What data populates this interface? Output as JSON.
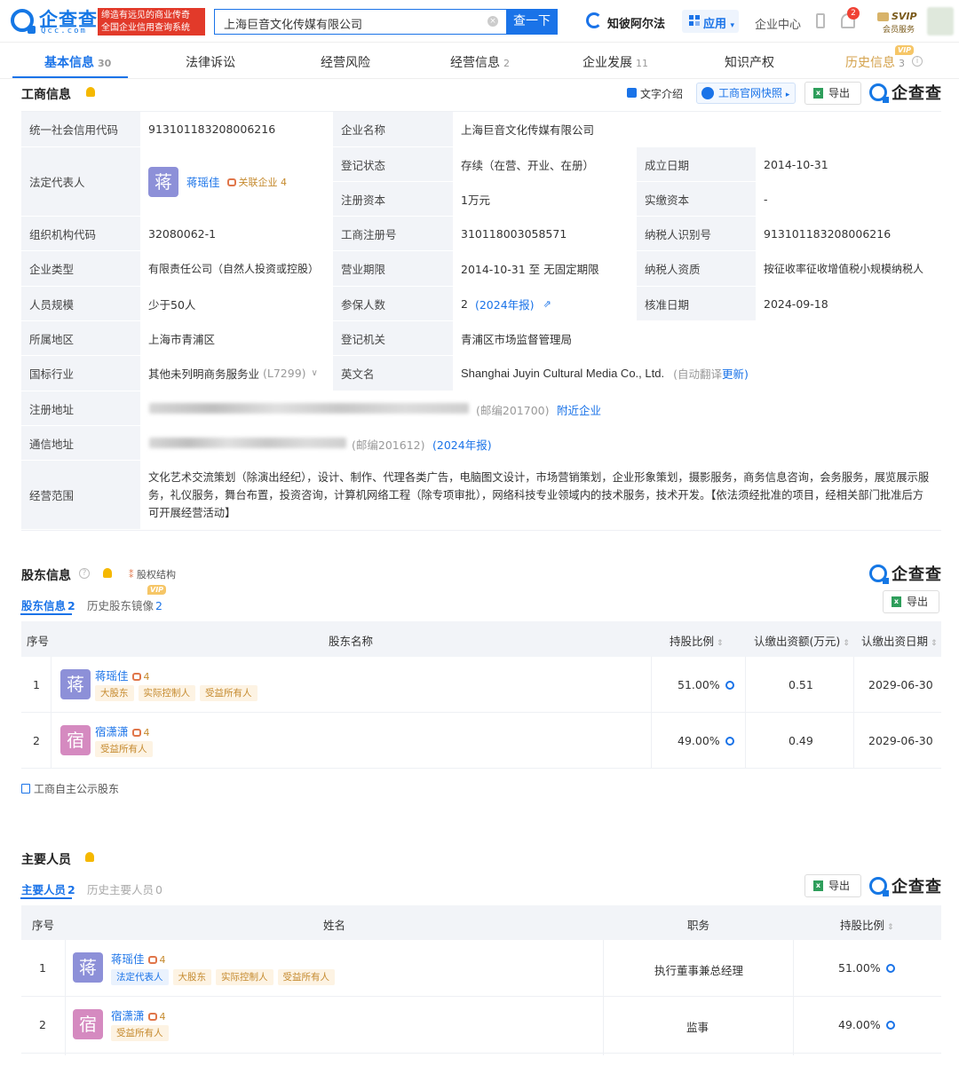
{
  "header": {
    "logo_text": "企查查",
    "logo_sub": "Qcc.com",
    "slogan_line1": "缔造有远见的商业传奇",
    "slogan_line2": "全国企业信用查询系统",
    "search_value": "上海巨音文化传媒有限公司",
    "search_button": "查一下",
    "zhibi_label": "知彼阿尔法",
    "app_label": "应用",
    "enterprise_center": "企业中心",
    "notification_count": "2",
    "svip_label": "SVIP",
    "svip_sub": "会员服务"
  },
  "tabs": [
    {
      "label": "基本信息",
      "count": "30"
    },
    {
      "label": "法律诉讼",
      "count": ""
    },
    {
      "label": "经营风险",
      "count": ""
    },
    {
      "label": "经营信息",
      "count": "2"
    },
    {
      "label": "企业发展",
      "count": "11"
    },
    {
      "label": "知识产权",
      "count": ""
    },
    {
      "label": "历史信息",
      "count": "3",
      "vip": "VIP"
    }
  ],
  "business": {
    "title": "工商信息",
    "text_intro": "文字介绍",
    "official_snapshot": "工商官网快照",
    "export": "导出",
    "logo": "企查查",
    "rows": {
      "credit_code_label": "统一社会信用代码",
      "credit_code": "913101183208006216",
      "company_name_label": "企业名称",
      "company_name": "上海巨音文化传媒有限公司",
      "legal_rep_label": "法定代表人",
      "legal_rep_avatar": "蒋",
      "legal_rep_name": "蒋瑶佳",
      "related_label": "关联企业",
      "related_count": "4",
      "reg_status_label": "登记状态",
      "reg_status": "存续（在营、开业、在册）",
      "found_date_label": "成立日期",
      "found_date": "2014-10-31",
      "reg_capital_label": "注册资本",
      "reg_capital": "1万元",
      "paid_capital_label": "实缴资本",
      "paid_capital": "-",
      "org_code_label": "组织机构代码",
      "org_code": "32080062-1",
      "reg_no_label": "工商注册号",
      "reg_no": "310118003058571",
      "taxpayer_id_label": "纳税人识别号",
      "taxpayer_id": "913101183208006216",
      "company_type_label": "企业类型",
      "company_type": "有限责任公司（自然人投资或控股）",
      "term_label": "营业期限",
      "term": "2014-10-31 至 无固定期限",
      "taxpayer_qual_label": "纳税人资质",
      "taxpayer_qual": "按征收率征收增值税小规模纳税人",
      "staff_label": "人员规模",
      "staff": "少于50人",
      "insured_label": "参保人数",
      "insured": "2",
      "insured_year": "(2024年报)",
      "approve_date_label": "核准日期",
      "approve_date": "2024-09-18",
      "region_label": "所属地区",
      "region": "上海市青浦区",
      "authority_label": "登记机关",
      "authority": "青浦区市场监督管理局",
      "industry_label": "国标行业",
      "industry": "其他未列明商务服务业",
      "industry_code": "(L7299)",
      "english_label": "英文名",
      "english": "Shanghai Juyin Cultural Media Co., Ltd.",
      "auto_translate": "(自动翻译",
      "update": "更新)",
      "reg_addr_label": "注册地址",
      "reg_zip": "(邮编201700)",
      "nearby": "附近企业",
      "mail_addr_label": "通信地址",
      "mail_zip": "(邮编201612)",
      "mail_year": "(2024年报)",
      "scope_label": "经营范围",
      "scope": "文化艺术交流策划（除演出经纪），设计、制作、代理各类广告，电脑图文设计，市场营销策划，企业形象策划，摄影服务，商务信息咨询，会务服务，展览展示服务，礼仪服务，舞台布置，投资咨询，计算机网络工程（除专项审批），网络科技专业领域内的技术服务，技术开发。【依法须经批准的项目，经相关部门批准后方可开展经营活动】"
    }
  },
  "shareholders": {
    "title": "股东信息",
    "equity_structure": "股权结构",
    "logo": "企查查",
    "export": "导出",
    "subtab_current": "股东信息",
    "subtab_current_count": "2",
    "subtab_history": "历史股东镜像",
    "subtab_history_count": "2",
    "vip": "VIP",
    "headers": {
      "no": "序号",
      "name": "股东名称",
      "ratio": "持股比例",
      "amount": "认缴出资额(万元)",
      "date": "认缴出资日期"
    },
    "rows": [
      {
        "no": "1",
        "avatar": "蒋",
        "name": "蒋瑶佳",
        "related": "4",
        "tags": [
          "大股东",
          "实际控制人",
          "受益所有人"
        ],
        "ratio": "51.00%",
        "amount": "0.51",
        "date": "2029-06-30"
      },
      {
        "no": "2",
        "avatar": "宿",
        "name": "宿潇潇",
        "related": "4",
        "tags": [
          "受益所有人"
        ],
        "ratio": "49.00%",
        "amount": "0.49",
        "date": "2029-06-30"
      }
    ],
    "self_public": "工商自主公示股东"
  },
  "personnel": {
    "title": "主要人员",
    "export": "导出",
    "logo": "企查查",
    "subtab_current": "主要人员",
    "subtab_current_count": "2",
    "subtab_history": "历史主要人员",
    "subtab_history_count": "0",
    "headers": {
      "no": "序号",
      "name": "姓名",
      "position": "职务",
      "ratio": "持股比例"
    },
    "rows": [
      {
        "no": "1",
        "avatar": "蒋",
        "name": "蒋瑶佳",
        "related": "4",
        "tags": [
          "法定代表人",
          "大股东",
          "实际控制人",
          "受益所有人"
        ],
        "position": "执行董事兼总经理",
        "ratio": "51.00%"
      },
      {
        "no": "2",
        "avatar": "宿",
        "name": "宿潇潇",
        "related": "4",
        "tags": [
          "受益所有人"
        ],
        "position": "监事",
        "ratio": "49.00%"
      }
    ]
  },
  "colors": {
    "accent": "#1a73e8",
    "label_bg": "#f2f4f8",
    "tag": "#c58a2e"
  }
}
